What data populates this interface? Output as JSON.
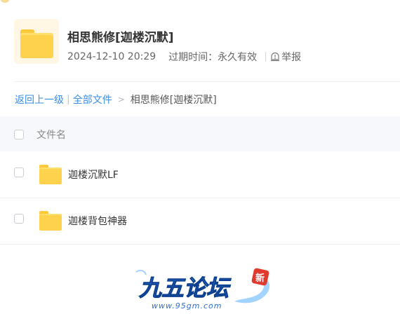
{
  "share": {
    "title": "相思熊修[迦楼沉默]",
    "date": "2024-12-10 20:29",
    "expire_label": "过期时间：",
    "expire_value": "永久有效",
    "report_label": "举报"
  },
  "breadcrumb": {
    "back": "返回上一级",
    "all_files": "全部文件",
    "chevron": ">",
    "current": "相思熊修[迦楼沉默]"
  },
  "table": {
    "column_name": "文件名",
    "rows": [
      {
        "name": "迦楼沉默LF",
        "icon": "folder-icon"
      },
      {
        "name": "迦楼背包神器",
        "icon": "folder-icon"
      }
    ]
  },
  "watermark": {
    "logo_text": "九五论坛",
    "badge": "新",
    "url": "www.95gm.com"
  },
  "colors": {
    "link": "#3a8ee6",
    "folder": "#ffd24d",
    "header_bg": "#f6f8fb",
    "logo_blue": "#2a6fd1",
    "badge_red": "#e03a2f"
  }
}
